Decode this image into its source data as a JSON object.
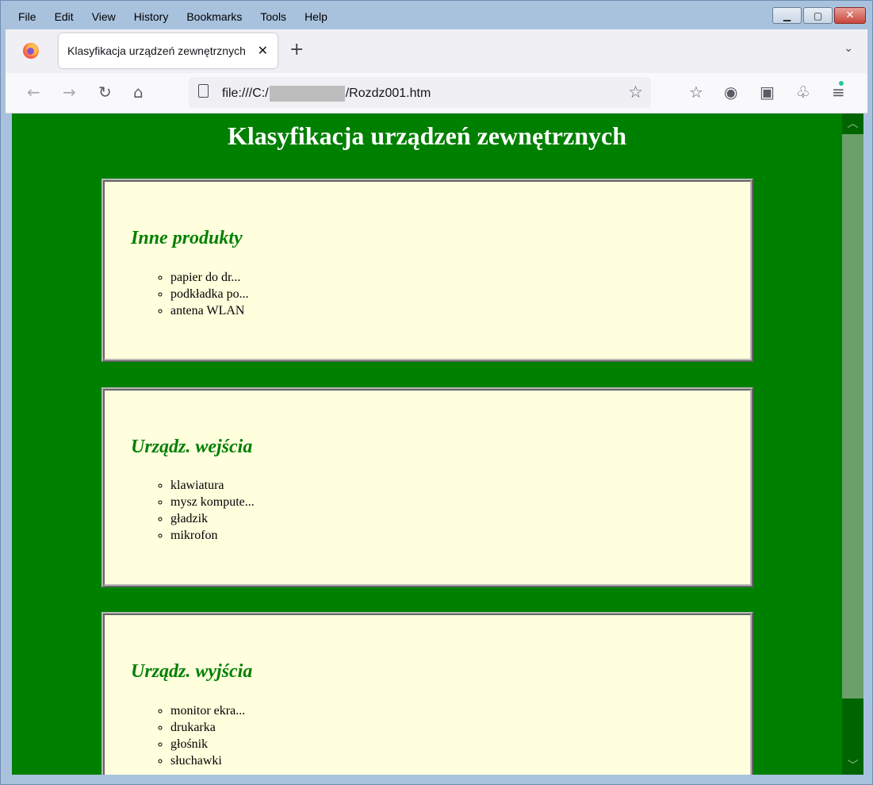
{
  "menu": [
    "File",
    "Edit",
    "View",
    "History",
    "Bookmarks",
    "Tools",
    "Help"
  ],
  "window_controls": {
    "minimize": "▁",
    "maximize": "▢",
    "close": "✕"
  },
  "tab": {
    "title": "Klasyfikacja urządzeń zewnętrznych",
    "close_glyph": "✕"
  },
  "tabstrip": {
    "new_tab_glyph": "+",
    "list_all_glyph": "⌄"
  },
  "nav": {
    "back_glyph": "←",
    "forward_glyph": "→",
    "reload_glyph": "↻",
    "home_glyph": "⌂",
    "url_prefix": "file:///C:/",
    "url_suffix": "/Rozdz001.htm",
    "bookmark_glyph": "☆",
    "pocket_glyph": "☆",
    "account_glyph": "◉",
    "library_glyph": "▣",
    "extensions_glyph": "♧",
    "menu_glyph": "≡"
  },
  "icons": {
    "firefox": "firefox-logo-icon",
    "page": "page-icon"
  },
  "page": {
    "title": "Klasyfikacja urządzeń zewnętrznych",
    "sections": [
      {
        "heading": "Inne produkty",
        "items": [
          "papier do dr...",
          "podkładka po...",
          "antena WLAN"
        ]
      },
      {
        "heading": "Urządz. wejścia",
        "items": [
          "klawiatura",
          "mysz kompute...",
          "gładzik",
          "mikrofon"
        ]
      },
      {
        "heading": "Urządz. wyjścia",
        "items": [
          "monitor ekra...",
          "drukarka",
          "głośnik",
          "słuchawki"
        ]
      }
    ]
  },
  "colors": {
    "page_background": "#008000",
    "box_background": "#ffffdd",
    "heading": "#008000",
    "title": "#ffffff"
  }
}
